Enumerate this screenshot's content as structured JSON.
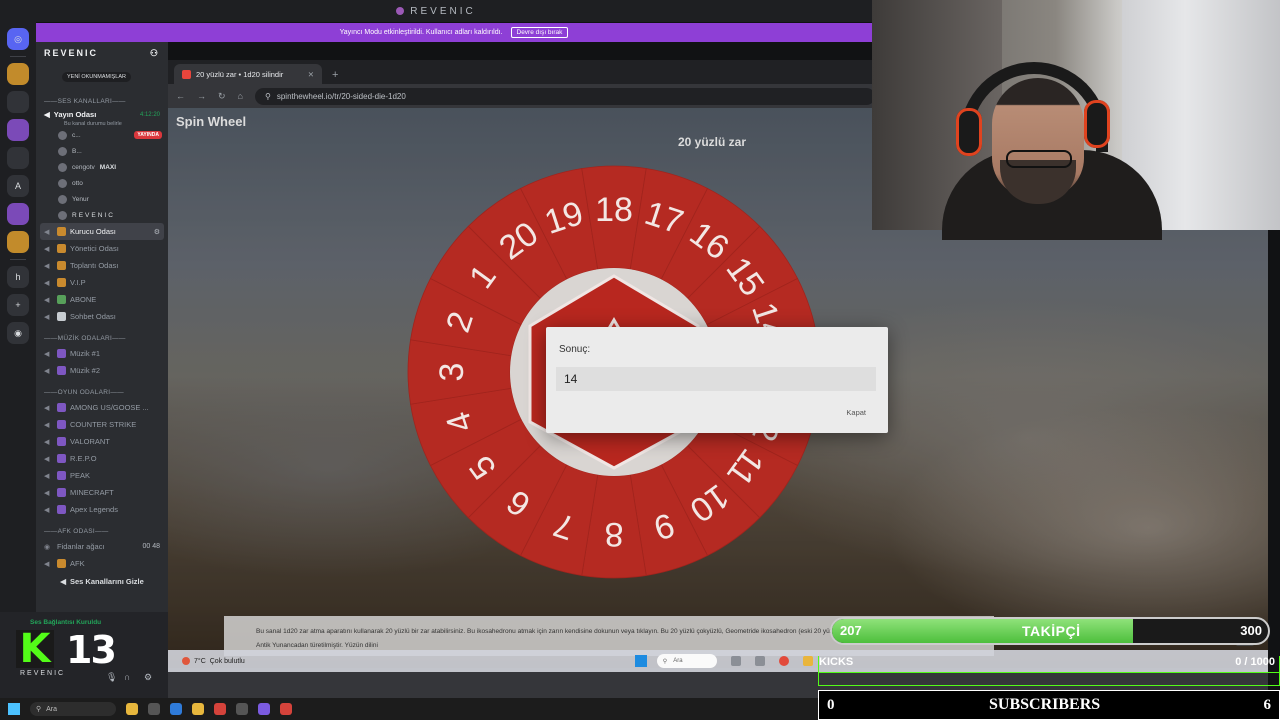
{
  "discord": {
    "window_title": "REVENIC",
    "streamer_banner": {
      "text": "Yayıncı Modu etkinleştirildi. Kullanıcı adları kaldırıldı.",
      "button": "Devre dışı bırak"
    },
    "rail": [
      "A",
      "h"
    ],
    "server_name": "REVENIC",
    "unread_pill": "YENİ OKUNMAMIŞLAR",
    "categories": {
      "voice": "SES KANALLARI",
      "music": "MÜZİK ODALARI",
      "games": "OYUN ODALARI",
      "afk": "AFK ODASI"
    },
    "live_channel": {
      "name": "Yayın Odası",
      "status": "Bu kanal durumu belirle",
      "time": "4:12:20"
    },
    "members": [
      {
        "name": "c...",
        "badge": "YAYINDA"
      },
      {
        "name": "B...",
        "badge": ""
      },
      {
        "name": "cengotv",
        "badge": "MAXI"
      },
      {
        "name": "otto",
        "badge": ""
      },
      {
        "name": "Yenur",
        "badge": ""
      },
      {
        "name": "REVENIC",
        "badge": ""
      }
    ],
    "voice_channels": [
      "Kurucu Odası",
      "Yönetici Odası",
      "Toplantı Odası",
      "V.I.P",
      "ABONE",
      "Sohbet Odası"
    ],
    "music_channels": [
      "Müzik #1",
      "Müzik #2"
    ],
    "game_channels": [
      "AMONG US/GOOSE ...",
      "COUNTER STRIKE",
      "VALORANT",
      "R.E.P.O",
      "PEAK",
      "MINECRAFT",
      "Apex Legends"
    ],
    "afk_channels": [
      {
        "name": "Fidanlar ağacı",
        "count_a": "00",
        "count_b": "48"
      },
      {
        "name": "AFK"
      }
    ],
    "hide_channels": "Ses Kanallarını Gizle",
    "voice_connected": "Ses Bağlantısı Kuruldu",
    "user_name": "REVENIC"
  },
  "kick_overlay": {
    "logo_letter": "K",
    "number": "13"
  },
  "browser": {
    "tab_title": "20 yüzlü zar • 1d20 silindir",
    "url": "spinthewheel.io/tr/20-sided-die-1d20",
    "site_title": "Spin Wheel",
    "wheel_title": "20 yüzlü zar",
    "scroll_icon": "⌄",
    "result_dialog": {
      "label": "Sonuç:",
      "value": "14",
      "close": "Kapat"
    },
    "description": "Bu sanal 1d20 zar atma aparatını kullanarak 20 yüzlü bir zar atabilirsiniz. Bu ikosahedronu atmak için zarın kendisine dokunun veya tıklayın. Bu 20 yüzlü çokyüzlü, Geometride ikosahedron (eski 20 yüzlü çokyüzlü) eskisinin adı de Yunanca ve Antik Yunancadan türetilmiştir. Yüzün dilini",
    "inner_taskbar": {
      "weather_temp": "7°C",
      "weather_text": "Çok bulutlu",
      "search": "Ara"
    }
  },
  "chart_data": {
    "type": "pie",
    "categories": [
      "1",
      "2",
      "3",
      "4",
      "5",
      "6",
      "7",
      "8",
      "9",
      "10",
      "11",
      "12",
      "13",
      "14",
      "15",
      "16",
      "17",
      "18",
      "19",
      "20"
    ],
    "values": [
      1,
      1,
      1,
      1,
      1,
      1,
      1,
      1,
      1,
      1,
      1,
      1,
      1,
      1,
      1,
      1,
      1,
      1,
      1,
      1
    ],
    "color": "#b52a22"
  },
  "overlay": {
    "followers": {
      "current": "207",
      "label": "TAKİPÇİ",
      "goal": "300",
      "fraction": 0.69
    },
    "kicks": {
      "label": "KICKS",
      "count": "0 / 1000"
    },
    "subscribers": {
      "current": "0",
      "label": "SUBSCRIBERS",
      "goal": "6"
    }
  },
  "taskbar": {
    "search": "Ara"
  }
}
